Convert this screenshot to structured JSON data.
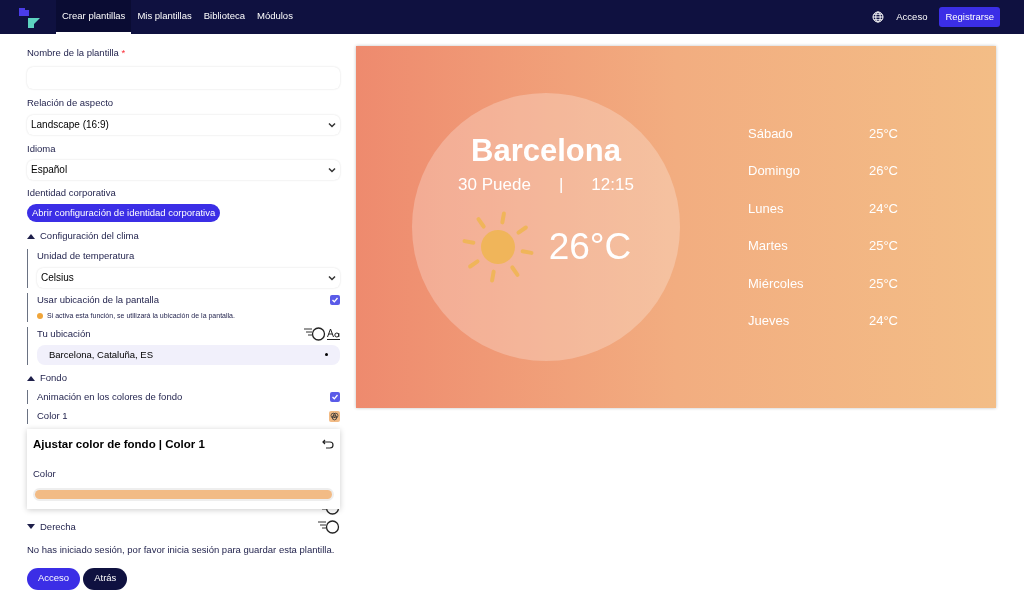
{
  "nav": {
    "tabs": [
      {
        "label": "Crear plantillas",
        "selected": true
      },
      {
        "label": "Mis plantillas",
        "selected": false
      },
      {
        "label": "Biblioteca",
        "selected": false
      },
      {
        "label": "Módulos",
        "selected": false
      }
    ],
    "login": "Acceso",
    "register": "Registrarse"
  },
  "form": {
    "name_label": "Nombre de la plantilla",
    "required_mark": "*",
    "aspect_label": "Relación de aspecto",
    "aspect_value": "Landscape (16:9)",
    "language_label": "Idioma",
    "language_value": "Español",
    "brand_label": "Identidad corporativa",
    "brand_button": "Abrir configuración de identidad corporativa",
    "sections": [
      {
        "title": "Configuración del clima",
        "expanded": true,
        "rows": [
          {
            "kind": "select",
            "label": "Unidad de temperatura",
            "value": "Celsius"
          },
          {
            "kind": "checkbox",
            "label": "Usar ubicación de la pantalla",
            "checked": true,
            "hint": "Si activa esta función, se utilizará la ubicación de la pantalla."
          },
          {
            "kind": "location",
            "label": "Tu ubicación",
            "value": "Barcelona, Cataluña, ES"
          }
        ]
      },
      {
        "title": "Fondo",
        "expanded": true,
        "rows": [
          {
            "kind": "checkbox",
            "label": "Animación en los colores de fondo",
            "checked": true
          },
          {
            "kind": "color",
            "label": "Color 1",
            "color": "#f2bb85"
          },
          {
            "kind": "hidden"
          }
        ]
      },
      {
        "title": "Derecha",
        "expanded": false
      }
    ],
    "notice": "No has iniciado sesión, por favor inicia sesión para guardar esta plantilla.",
    "buttons": [
      {
        "kind": "primary",
        "label": "Acceso"
      },
      {
        "kind": "dark",
        "label": "Atrás"
      }
    ]
  },
  "popover": {
    "title": "Ajustar color de fondo | Color 1",
    "field_label": "Color",
    "color": "#f2bb85"
  },
  "preview": {
    "city": "Barcelona",
    "date": "30 Puede",
    "separator": "|",
    "time": "12:15",
    "temperature": "26°C",
    "forecast": [
      {
        "day": "Sábado",
        "temp": "25°C"
      },
      {
        "day": "Domingo",
        "temp": "26°C"
      },
      {
        "day": "Lunes",
        "temp": "24°C"
      },
      {
        "day": "Martes",
        "temp": "25°C"
      },
      {
        "day": "Miércoles",
        "temp": "25°C"
      },
      {
        "day": "Jueves",
        "temp": "24°C"
      }
    ]
  }
}
